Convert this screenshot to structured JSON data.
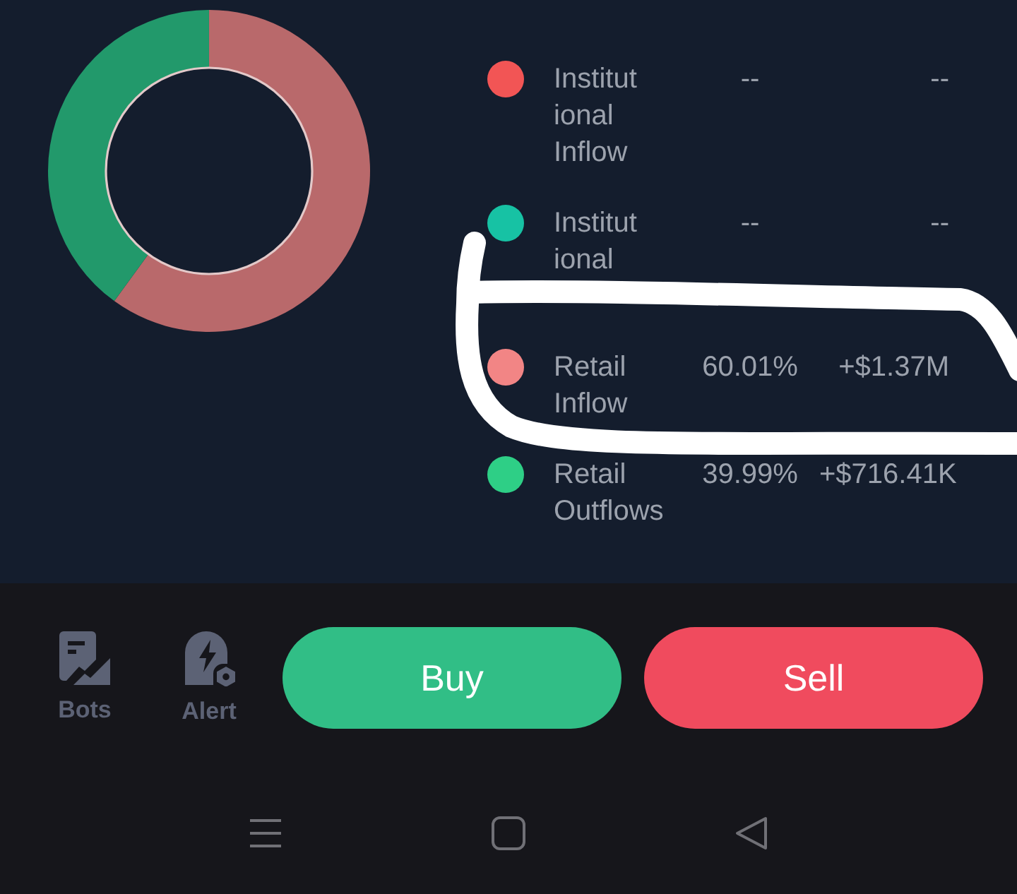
{
  "donut": {
    "chart_data": {
      "type": "donut",
      "values": [
        60.01,
        39.99
      ],
      "colors": [
        "#b9696b",
        "#22996b"
      ]
    }
  },
  "legend": [
    {
      "label_lines": [
        "Institut",
        "ional",
        "Inflow"
      ],
      "color": "#f25555",
      "percent": "--",
      "amount": "--"
    },
    {
      "label_lines": [
        "Institut",
        "ional"
      ],
      "color": "#17c2a4",
      "percent": "--",
      "amount": "--"
    },
    {
      "label_lines": [
        "Retail",
        "Inflow"
      ],
      "color": "#f28585",
      "percent": "60.01%",
      "amount": "+$1.37M"
    },
    {
      "label_lines": [
        "Retail",
        "Outflows"
      ],
      "color": "#2ecf86",
      "percent": "39.99%",
      "amount": "+$716.41K"
    }
  ],
  "annotations": [
    {
      "kind": "freehand_loop"
    }
  ],
  "toolbar": {
    "items": [
      {
        "kind": "bots",
        "label": "Bots"
      },
      {
        "kind": "alert",
        "label": "Alert"
      }
    ],
    "buttons": [
      {
        "kind": "buy",
        "label": "Buy"
      },
      {
        "kind": "sell",
        "label": "Sell"
      }
    ]
  },
  "nav_bar": [
    {
      "kind": "menu"
    },
    {
      "kind": "home"
    },
    {
      "kind": "back"
    }
  ]
}
